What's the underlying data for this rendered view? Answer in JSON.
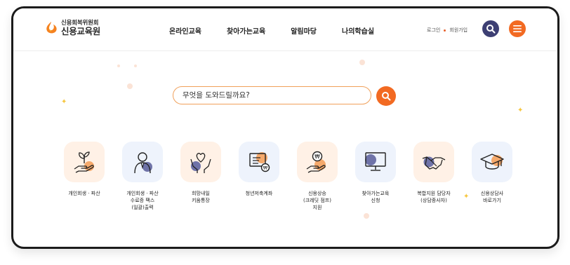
{
  "header": {
    "logo_small": "신용회복위원회",
    "logo_big": "신용교육원",
    "nav": [
      "온라인교육",
      "찾아가는교육",
      "알림마당",
      "나의학습실"
    ],
    "login": "로그인",
    "signup": "회원가입"
  },
  "search": {
    "placeholder": "무엇을 도와드릴까요?"
  },
  "quick_links": [
    {
      "label": "개인회생 · 파산",
      "icon": "plant-hand-icon"
    },
    {
      "label": "개인회생 · 파산\n수료증 팩스\n(일괄)출력",
      "icon": "person-icon"
    },
    {
      "label": "희망내일\n키움통장",
      "icon": "heart-hands-icon"
    },
    {
      "label": "청년저축계좌",
      "icon": "monitor-won-icon"
    },
    {
      "label": "신용상승\n(크레딧 점프)\n지원",
      "icon": "coin-hand-icon"
    },
    {
      "label": "찾아가는교육\n신청",
      "icon": "desktop-icon"
    },
    {
      "label": "복합지원 담당자\n(상담종사자)",
      "icon": "handshake-icon"
    },
    {
      "label": "신용상담사\n바로가기",
      "icon": "graduation-cap-icon"
    }
  ],
  "colors": {
    "accent": "#f26a22",
    "navy": "#3d3f73",
    "search_border": "#f0a05a"
  }
}
